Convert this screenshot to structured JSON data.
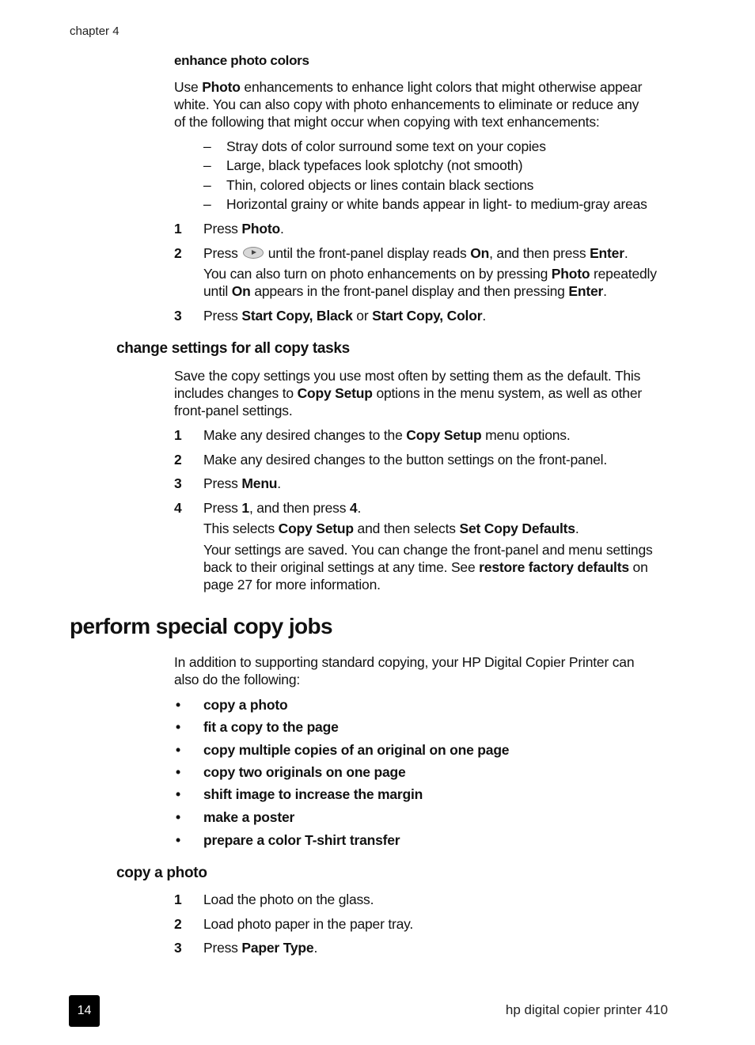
{
  "header": {
    "running_head": "chapter 4"
  },
  "enhance": {
    "heading": "enhance photo colors",
    "intro": {
      "pre": "Use ",
      "bold": "Photo",
      "line1_post": " enhancements to enhance light colors that might otherwise appear",
      "line2": "white. You can also copy with photo enhancements to eliminate or reduce any",
      "line3": "of the following that might occur when copying with text enhancements:"
    },
    "dash_marker": "–",
    "issues": [
      "Stray dots of color surround some text on your copies",
      "Large, black typefaces look splotchy (not smooth)",
      "Thin, colored objects or lines contain black sections",
      "Horizontal grainy or white bands appear in light- to medium-gray areas"
    ],
    "steps": [
      {
        "num": "1",
        "pre": "Press ",
        "bold": "Photo",
        "post": "."
      },
      {
        "num": "2",
        "pre": "Press",
        "icon": "right-arrow-button-icon",
        "mid": "until the front-panel display reads ",
        "bold1": "On",
        "mid2": ", and then press ",
        "bold2": "Enter",
        "post": ".",
        "note": {
          "pre": "You can also turn on photo enhancements on by pressing ",
          "bold1": "Photo",
          "mid": " repeatedly",
          "line2_pre": "until ",
          "bold2": "On",
          "line2_mid": " appears in the front-panel display and then pressing ",
          "bold3": "Enter",
          "post": "."
        }
      },
      {
        "num": "3",
        "pre": "Press ",
        "bold1": "Start Copy, Black",
        "mid": " or ",
        "bold2": "Start Copy, Color",
        "post": "."
      }
    ]
  },
  "change_settings": {
    "heading": "change settings for all copy tasks",
    "intro": {
      "line1": "Save the copy settings you use most often by setting them as the default. This",
      "line2_pre": "includes changes to ",
      "line2_bold": "Copy Setup",
      "line2_post": " options in the menu system, as well as other",
      "line3": "front-panel settings."
    },
    "steps": [
      {
        "num": "1",
        "pre": "Make any desired changes to the ",
        "bold": "Copy Setup",
        "post": " menu options."
      },
      {
        "num": "2",
        "text": "Make any desired changes to the button settings on the front-panel."
      },
      {
        "num": "3",
        "pre": "Press ",
        "bold": "Menu",
        "post": "."
      },
      {
        "num": "4",
        "pre": "Press ",
        "bold1": "1",
        "mid": ", and then press ",
        "bold2": "4",
        "post": ".",
        "note1": {
          "pre": "This selects ",
          "bold1": "Copy Setup",
          "mid": " and then selects ",
          "bold2": "Set Copy Defaults",
          "post": "."
        },
        "note2": {
          "line1": "Your settings are saved. You can change the front-panel and menu settings",
          "line2_pre": "back to their original settings at any time. See ",
          "line2_bold": "restore factory defaults",
          "line2_post": " on",
          "line3": "page 27 for more information."
        }
      }
    ]
  },
  "special": {
    "heading": "perform special copy jobs",
    "intro_line1": "In addition to supporting standard copying, your HP Digital Copier Printer can",
    "intro_line2": "also do the following:",
    "bullet_marker": "•",
    "jobs": [
      "copy a photo",
      "fit a copy to the page",
      "copy multiple copies of an original on one page",
      "copy two originals on one page",
      "shift image to increase the margin",
      "make a poster",
      "prepare a color T-shirt transfer"
    ]
  },
  "copy_photo": {
    "heading": "copy a photo",
    "steps": [
      {
        "num": "1",
        "text": "Load the photo on the glass."
      },
      {
        "num": "2",
        "text": "Load photo paper in the paper tray."
      },
      {
        "num": "3",
        "pre": "Press ",
        "bold": "Paper Type",
        "post": "."
      }
    ]
  },
  "footer": {
    "page_number": "14",
    "title": "hp digital copier printer 410"
  }
}
